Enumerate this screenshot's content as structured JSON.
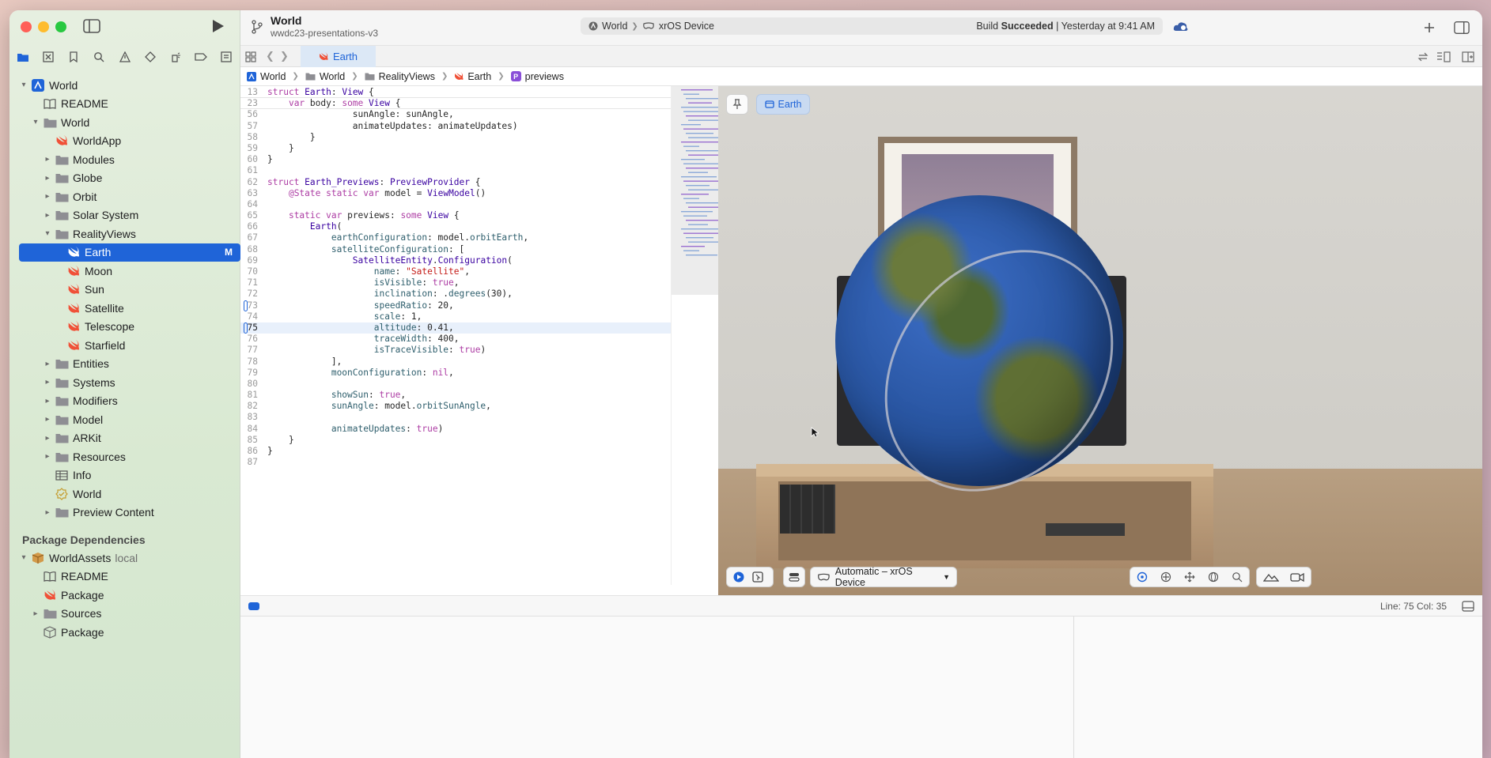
{
  "toolbar": {
    "project_title": "World",
    "project_subtitle": "wwdc23-presentations-v3",
    "scheme": "World",
    "destination": "xrOS Device",
    "status_prefix": "Build",
    "status_bold": "Succeeded",
    "status_suffix": "| Yesterday at 9:41 AM"
  },
  "tab": {
    "label": "Earth"
  },
  "breadcrumb": [
    "World",
    "World",
    "RealityViews",
    "Earth",
    "previews"
  ],
  "sidebar": {
    "tree": [
      {
        "label": "World",
        "icon": "app-icon",
        "depth": 0,
        "disclosure": "open"
      },
      {
        "label": "README",
        "icon": "book-icon",
        "depth": 1,
        "disclosure": ""
      },
      {
        "label": "World",
        "icon": "folder-icon",
        "depth": 1,
        "disclosure": "open"
      },
      {
        "label": "WorldApp",
        "icon": "swift-icon",
        "depth": 2,
        "disclosure": ""
      },
      {
        "label": "Modules",
        "icon": "folder-icon",
        "depth": 2,
        "disclosure": "closed"
      },
      {
        "label": "Globe",
        "icon": "folder-icon",
        "depth": 2,
        "disclosure": "closed"
      },
      {
        "label": "Orbit",
        "icon": "folder-icon",
        "depth": 2,
        "disclosure": "closed"
      },
      {
        "label": "Solar System",
        "icon": "folder-icon",
        "depth": 2,
        "disclosure": "closed"
      },
      {
        "label": "RealityViews",
        "icon": "folder-icon",
        "depth": 2,
        "disclosure": "open"
      },
      {
        "label": "Earth",
        "icon": "swift-icon",
        "depth": 3,
        "disclosure": "",
        "selected": true,
        "badge": "M"
      },
      {
        "label": "Moon",
        "icon": "swift-icon",
        "depth": 3,
        "disclosure": ""
      },
      {
        "label": "Sun",
        "icon": "swift-icon",
        "depth": 3,
        "disclosure": ""
      },
      {
        "label": "Satellite",
        "icon": "swift-icon",
        "depth": 3,
        "disclosure": ""
      },
      {
        "label": "Telescope",
        "icon": "swift-icon",
        "depth": 3,
        "disclosure": ""
      },
      {
        "label": "Starfield",
        "icon": "swift-icon",
        "depth": 3,
        "disclosure": ""
      },
      {
        "label": "Entities",
        "icon": "folder-icon",
        "depth": 2,
        "disclosure": "closed"
      },
      {
        "label": "Systems",
        "icon": "folder-icon",
        "depth": 2,
        "disclosure": "closed"
      },
      {
        "label": "Modifiers",
        "icon": "folder-icon",
        "depth": 2,
        "disclosure": "closed"
      },
      {
        "label": "Model",
        "icon": "folder-icon",
        "depth": 2,
        "disclosure": "closed"
      },
      {
        "label": "ARKit",
        "icon": "folder-icon",
        "depth": 2,
        "disclosure": "closed"
      },
      {
        "label": "Resources",
        "icon": "folder-icon",
        "depth": 2,
        "disclosure": "closed"
      },
      {
        "label": "Info",
        "icon": "table-icon",
        "depth": 2,
        "disclosure": ""
      },
      {
        "label": "World",
        "icon": "entitlements-icon",
        "depth": 2,
        "disclosure": ""
      },
      {
        "label": "Preview Content",
        "icon": "folder-icon",
        "depth": 2,
        "disclosure": "closed"
      }
    ],
    "package_section": "Package Dependencies",
    "packages": [
      {
        "label": "WorldAssets",
        "suffix": "local",
        "icon": "package-box-icon",
        "depth": 0,
        "disclosure": "open"
      },
      {
        "label": "README",
        "icon": "book-icon",
        "depth": 1,
        "disclosure": ""
      },
      {
        "label": "Package",
        "icon": "swift-icon",
        "depth": 1,
        "disclosure": ""
      },
      {
        "label": "Sources",
        "icon": "folder-icon",
        "depth": 1,
        "disclosure": "closed"
      },
      {
        "label": "Package",
        "icon": "package-icon",
        "depth": 1,
        "disclosure": ""
      }
    ]
  },
  "code": {
    "sticky": [
      {
        "n": "13",
        "html": "<span class='kw'>struct</span> <span class='ty'>Earth</span>: <span class='ty'>View</span> {"
      },
      {
        "n": "23",
        "html": "    <span class='kw'>var</span> body: <span class='kw'>some</span> <span class='ty'>View</span> {"
      }
    ],
    "lines": [
      {
        "n": "56",
        "html": "                sunAngle: sunAngle,"
      },
      {
        "n": "57",
        "html": "                animateUpdates: animateUpdates)"
      },
      {
        "n": "58",
        "html": "        }"
      },
      {
        "n": "59",
        "html": "    }"
      },
      {
        "n": "60",
        "html": "}"
      },
      {
        "n": "61",
        "html": ""
      },
      {
        "n": "62",
        "html": "<span class='kw'>struct</span> <span class='ty'>Earth_Previews</span>: <span class='ty'>PreviewProvider</span> {"
      },
      {
        "n": "63",
        "html": "    <span class='kw'>@State</span> <span class='kw'>static</span> <span class='kw'>var</span> model = <span class='ty'>ViewModel</span>()"
      },
      {
        "n": "64",
        "html": ""
      },
      {
        "n": "65",
        "html": "    <span class='kw'>static</span> <span class='kw'>var</span> previews: <span class='kw'>some</span> <span class='ty'>View</span> {"
      },
      {
        "n": "66",
        "html": "        <span class='ty'>Earth</span>("
      },
      {
        "n": "67",
        "html": "            <span class='fn'>earthConfiguration</span>: model.<span class='fn'>orbitEarth</span>,"
      },
      {
        "n": "68",
        "html": "            <span class='fn'>satelliteConfiguration</span>: ["
      },
      {
        "n": "69",
        "html": "                <span class='ty'>SatelliteEntity</span>.<span class='ty'>Configuration</span>("
      },
      {
        "n": "70",
        "html": "                    <span class='fn'>name</span>: <span class='st'>\"Satellite\"</span>,"
      },
      {
        "n": "71",
        "html": "                    <span class='fn'>isVisible</span>: <span class='kw'>true</span>,"
      },
      {
        "n": "72",
        "html": "                    <span class='fn'>inclination</span>: .<span class='fn'>degrees</span>(30),"
      },
      {
        "n": "73",
        "html": "                    <span class='fn'>speedRatio</span>: 20,",
        "mark": true
      },
      {
        "n": "74",
        "html": "                    <span class='fn'>scale</span>: 1,"
      },
      {
        "n": "75",
        "html": "                    <span class='fn'>altitude</span>: 0.41,",
        "mark": true,
        "current": true
      },
      {
        "n": "76",
        "html": "                    <span class='fn'>traceWidth</span>: 400,"
      },
      {
        "n": "77",
        "html": "                    <span class='fn'>isTraceVisible</span>: <span class='kw'>true</span>)"
      },
      {
        "n": "78",
        "html": "            ],"
      },
      {
        "n": "79",
        "html": "            <span class='fn'>moonConfiguration</span>: <span class='kw'>nil</span>,"
      },
      {
        "n": "80",
        "html": ""
      },
      {
        "n": "81",
        "html": "            <span class='fn'>showSun</span>: <span class='kw'>true</span>,"
      },
      {
        "n": "82",
        "html": "            <span class='fn'>sunAngle</span>: model.<span class='fn'>orbitSunAngle</span>,"
      },
      {
        "n": "83",
        "html": ""
      },
      {
        "n": "84",
        "html": "            <span class='fn'>animateUpdates</span>: <span class='kw'>true</span>)"
      },
      {
        "n": "85",
        "html": "    }"
      },
      {
        "n": "86",
        "html": "}"
      },
      {
        "n": "87",
        "html": ""
      }
    ]
  },
  "preview": {
    "chip_label": "Earth",
    "device_label": "Automatic – xrOS Device"
  },
  "status": {
    "position": "Line: 75  Col: 35"
  },
  "colors": {
    "accent": "#1f64d8",
    "swift": "#f05138",
    "folder": "#8e8e93"
  }
}
